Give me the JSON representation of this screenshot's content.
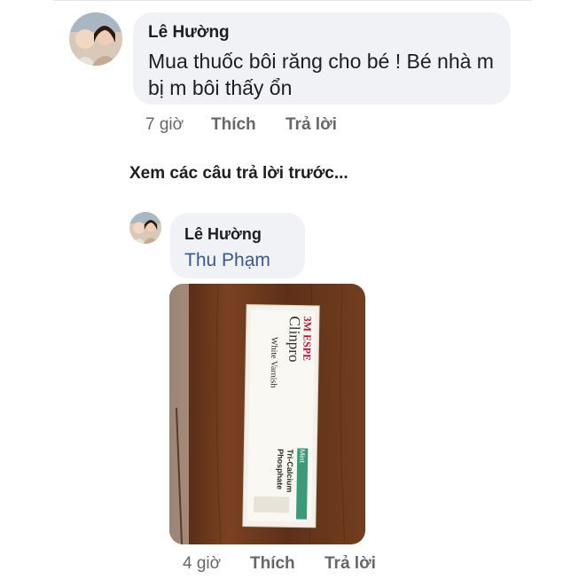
{
  "comment": {
    "author": "Lê Hường",
    "text": "Mua thuốc bôi răng cho bé ! Bé nhà m bị m bôi thấy ổn",
    "time": "7 giờ",
    "like_label": "Thích",
    "reply_label": "Trả lời"
  },
  "view_previous_label": "Xem các câu trả lời trước...",
  "reply": {
    "author": "Lê Hường",
    "mention": "Thu Phạm",
    "time": "4 giờ",
    "like_label": "Thích",
    "reply_label": "Trả lời",
    "photo": {
      "brand": "3M ESPE",
      "product": "Clinpro",
      "variant": "White Varnish",
      "flavor": "Mint",
      "ingredient_line1": "Tri-Calcium",
      "ingredient_line2": "Phosphate"
    }
  },
  "colors": {
    "bubble": "#f0f2f5",
    "link": "#385898",
    "meta": "#65676b",
    "wood": "#6b3a1e"
  }
}
